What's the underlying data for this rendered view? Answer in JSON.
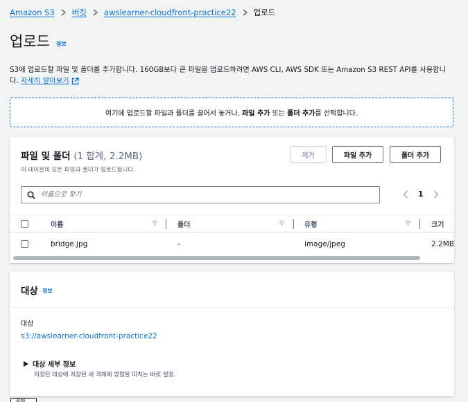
{
  "breadcrumb": {
    "items": [
      "Amazon S3",
      "버킷",
      "awslearner-cloudfront-practice22"
    ],
    "current": "업로드"
  },
  "page": {
    "title": "업로드",
    "info_link": "정보",
    "description_1": "S3에 업로드할 파일 및 폴더를 추가합니다. 160GB보다 큰 파일을 업로드하려면 AWS CLI, AWS SDK 또는 Amazon S3 REST API를 사용합니",
    "description_2": "다.",
    "learn_more": "자세히 알아보기"
  },
  "dropzone": {
    "text_1": "여기에 업로드할 파일과 폴더를 끌어서 놓거나, ",
    "bold_1": "파일 추가",
    "text_2": " 또는 ",
    "bold_2": "폴더 추가",
    "text_3": "를 선택합니다."
  },
  "files": {
    "title": "파일 및 폴더",
    "count": "(1 합계, 2.2MB)",
    "subtitle": "이 테이블의 모든 파일과 폴더가 업로드됩니다.",
    "remove_label": "제거",
    "add_files_label": "파일 추가",
    "add_folder_label": "폴더 추가",
    "search_placeholder": "이름으로 찾기",
    "page_number": "1",
    "columns": [
      "이름",
      "폴더",
      "유형",
      "크기"
    ],
    "rows": [
      {
        "name": "bridge.jpg",
        "folder": "-",
        "type": "image/jpeg",
        "size": "2.2MB"
      }
    ]
  },
  "target": {
    "title": "대상",
    "info_link": "정보",
    "label": "대상",
    "path": "s3://awslearner-cloudfront-practice22",
    "details_title": "대상 세부 정보",
    "details_desc": "지정된 대상에 저장된 새 객체에 영향을 미치는 버킷 설정."
  },
  "bottom": {
    "partial_label": "권한"
  },
  "colors": {
    "link": "#0972d3",
    "background": "#f2f3f3",
    "text": "#16191f"
  }
}
